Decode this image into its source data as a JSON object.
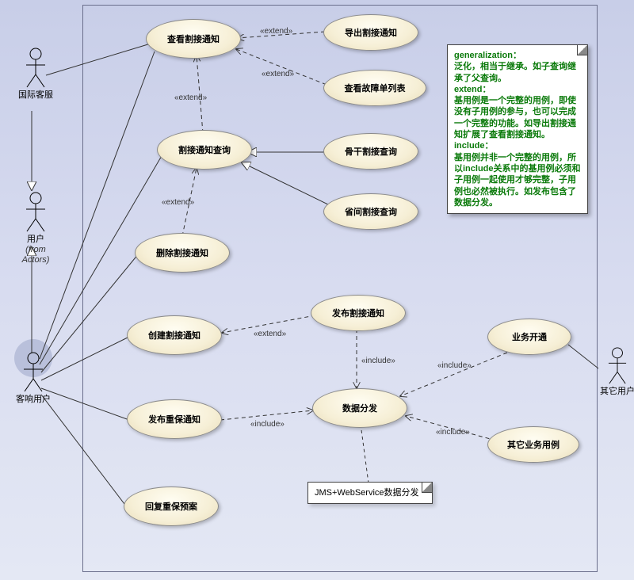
{
  "actors": {
    "intl": {
      "label": "国际客服"
    },
    "user": {
      "label": "用户",
      "sublabel": "(from Actors)"
    },
    "kx": {
      "label": "客响用户"
    },
    "other": {
      "label": "其它用户"
    }
  },
  "usecases": {
    "uc_view": "查看割接通知",
    "uc_export": "导出割接通知",
    "uc_fault": "查看故障单列表",
    "uc_query": "割接通知查询",
    "uc_backbone": "骨干割接查询",
    "uc_prov": "省间割接查询",
    "uc_delete": "删除割接通知",
    "uc_create": "创建割接通知",
    "uc_publish": "发布割接通知",
    "uc_biz_open": "业务开通",
    "uc_pub_zb": "发布重保通知",
    "uc_dist": "数据分发",
    "uc_other_biz": "其它业务用例",
    "uc_reply": "回复重保预案"
  },
  "stereotypes": {
    "extend": "«extend»",
    "include": "«include»"
  },
  "notes": {
    "green_title1": "generalization：",
    "green_body1": "泛化，相当于继承。如子查询继承了父查询。",
    "green_title2": "extend：",
    "green_body2": "基用例是一个完整的用例，即使没有子用例的参与，也可以完成一个完整的功能。如导出割接通知扩展了查看割接通知。",
    "green_title3": "include：",
    "green_body3": "基用例并非一个完整的用例，所以include关系中的基用例必须和子用例一起使用才够完整，子用例也必然被执行。如发布包含了数据分发。",
    "plain": "JMS+WebService数据分发"
  },
  "chart_data": {
    "type": "uml-use-case",
    "actors": [
      "国际客服",
      "用户",
      "客响用户",
      "其它用户"
    ],
    "actor_relations": [
      {
        "from": "国际客服",
        "to": "用户",
        "kind": "generalization"
      },
      {
        "from": "客响用户",
        "to": "用户",
        "kind": "generalization"
      }
    ],
    "use_cases": [
      "查看割接通知",
      "导出割接通知",
      "查看故障单列表",
      "割接通知查询",
      "骨干割接查询",
      "省间割接查询",
      "删除割接通知",
      "创建割接通知",
      "发布割接通知",
      "业务开通",
      "发布重保通知",
      "数据分发",
      "其它业务用例",
      "回复重保预案"
    ],
    "associations": [
      {
        "actor": "国际客服",
        "usecase": "查看割接通知"
      },
      {
        "actor": "客响用户",
        "usecase": "查看割接通知"
      },
      {
        "actor": "客响用户",
        "usecase": "割接通知查询"
      },
      {
        "actor": "客响用户",
        "usecase": "删除割接通知"
      },
      {
        "actor": "客响用户",
        "usecase": "创建割接通知"
      },
      {
        "actor": "客响用户",
        "usecase": "发布重保通知"
      },
      {
        "actor": "客响用户",
        "usecase": "回复重保预案"
      },
      {
        "actor": "其它用户",
        "usecase": "业务开通"
      }
    ],
    "extends": [
      {
        "from": "导出割接通知",
        "to": "查看割接通知"
      },
      {
        "from": "查看故障单列表",
        "to": "查看割接通知"
      },
      {
        "from": "割接通知查询",
        "to": "查看割接通知"
      },
      {
        "from": "删除割接通知",
        "to": "割接通知查询"
      },
      {
        "from": "发布割接通知",
        "to": "创建割接通知"
      }
    ],
    "includes": [
      {
        "from": "发布割接通知",
        "to": "数据分发"
      },
      {
        "from": "业务开通",
        "to": "数据分发"
      },
      {
        "from": "发布重保通知",
        "to": "数据分发"
      },
      {
        "from": "其它业务用例",
        "to": "数据分发"
      }
    ],
    "generalizations": [
      {
        "child": "骨干割接查询",
        "parent": "割接通知查询"
      },
      {
        "child": "省间割接查询",
        "parent": "割接通知查询"
      }
    ],
    "notes": [
      {
        "attached_to": "数据分发",
        "text": "JMS+WebService数据分发"
      }
    ]
  }
}
